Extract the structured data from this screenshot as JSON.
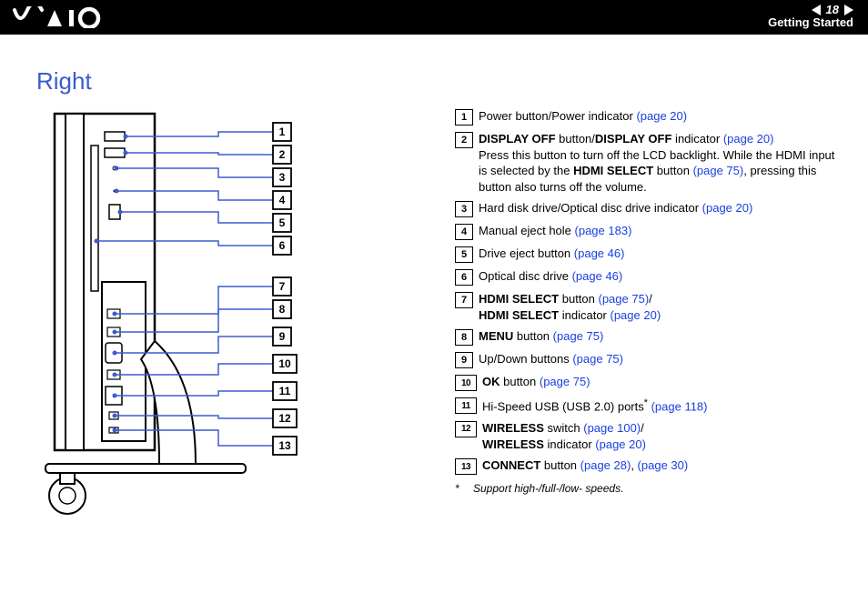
{
  "header": {
    "page_number": "18",
    "section": "Getting Started",
    "logo_alt": "VAIO"
  },
  "title": "Right",
  "diagram": {
    "callouts": [
      "1",
      "2",
      "3",
      "4",
      "5",
      "6",
      "7",
      "8",
      "9",
      "10",
      "11",
      "12",
      "13"
    ]
  },
  "legend": [
    {
      "num": "1",
      "parts": [
        {
          "t": "Power button/Power indicator "
        },
        {
          "t": "(page 20)",
          "link": true
        }
      ]
    },
    {
      "num": "2",
      "parts": [
        {
          "t": "DISPLAY OFF",
          "bold": true
        },
        {
          "t": " button/"
        },
        {
          "t": "DISPLAY OFF",
          "bold": true
        },
        {
          "t": " indicator "
        },
        {
          "t": "(page 20)",
          "link": true
        },
        {
          "br": true
        },
        {
          "t": "Press this button to turn off the LCD backlight. While the HDMI input is selected by the "
        },
        {
          "t": "HDMI SELECT",
          "bold": true
        },
        {
          "t": " button "
        },
        {
          "t": "(page 75)",
          "link": true
        },
        {
          "t": ", pressing this button also turns off the volume."
        }
      ]
    },
    {
      "num": "3",
      "parts": [
        {
          "t": "Hard disk drive/Optical disc drive indicator "
        },
        {
          "t": "(page 20)",
          "link": true
        }
      ]
    },
    {
      "num": "4",
      "parts": [
        {
          "t": "Manual eject hole "
        },
        {
          "t": "(page 183)",
          "link": true
        }
      ]
    },
    {
      "num": "5",
      "parts": [
        {
          "t": "Drive eject button "
        },
        {
          "t": "(page 46)",
          "link": true
        }
      ]
    },
    {
      "num": "6",
      "parts": [
        {
          "t": "Optical disc drive "
        },
        {
          "t": "(page 46)",
          "link": true
        }
      ]
    },
    {
      "num": "7",
      "parts": [
        {
          "t": "HDMI SELECT",
          "bold": true
        },
        {
          "t": " button "
        },
        {
          "t": "(page 75)",
          "link": true
        },
        {
          "t": "/"
        },
        {
          "br": true
        },
        {
          "t": "HDMI SELECT",
          "bold": true
        },
        {
          "t": " indicator "
        },
        {
          "t": "(page 20)",
          "link": true
        }
      ]
    },
    {
      "num": "8",
      "parts": [
        {
          "t": "MENU",
          "bold": true
        },
        {
          "t": " button "
        },
        {
          "t": "(page 75)",
          "link": true
        }
      ]
    },
    {
      "num": "9",
      "parts": [
        {
          "t": "Up/Down buttons "
        },
        {
          "t": "(page 75)",
          "link": true
        }
      ]
    },
    {
      "num": "10",
      "parts": [
        {
          "t": "OK",
          "bold": true
        },
        {
          "t": " button "
        },
        {
          "t": "(page 75)",
          "link": true
        }
      ]
    },
    {
      "num": "11",
      "parts": [
        {
          "t": "Hi-Speed USB (USB 2.0) ports"
        },
        {
          "t": "*",
          "sup": true
        },
        {
          "t": " "
        },
        {
          "t": "(page 118)",
          "link": true
        }
      ]
    },
    {
      "num": "12",
      "parts": [
        {
          "t": "WIRELESS",
          "bold": true
        },
        {
          "t": " switch "
        },
        {
          "t": "(page 100)",
          "link": true
        },
        {
          "t": "/"
        },
        {
          "br": true
        },
        {
          "t": "WIRELESS",
          "bold": true
        },
        {
          "t": " indicator "
        },
        {
          "t": "(page 20)",
          "link": true
        }
      ]
    },
    {
      "num": "13",
      "parts": [
        {
          "t": "CONNECT",
          "bold": true
        },
        {
          "t": " button "
        },
        {
          "t": "(page 28)",
          "link": true
        },
        {
          "t": ", "
        },
        {
          "t": "(page 30)",
          "link": true
        }
      ]
    }
  ],
  "footnote": {
    "mark": "*",
    "text": "Support high-/full-/low- speeds."
  }
}
